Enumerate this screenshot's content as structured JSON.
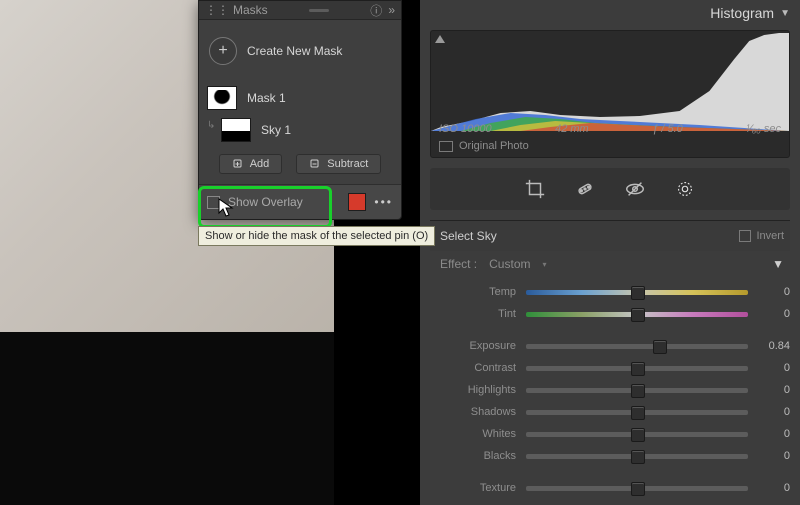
{
  "masks_panel": {
    "title": "Masks",
    "create_label": "Create New Mask",
    "items": [
      {
        "label": "Mask 1"
      },
      {
        "label": "Sky 1"
      }
    ],
    "add_label": "Add",
    "subtract_label": "Subtract",
    "show_overlay_label": "Show Overlay",
    "overlay_color": "#d63a2b",
    "tooltip": "Show or hide the mask of the selected pin (O)"
  },
  "right": {
    "histogram_title": "Histogram",
    "meta": {
      "iso": "ISO 10000",
      "focal": "42 mm",
      "aperture": "ƒ / 5.0",
      "shutter": "¹⁄₆₀ sec"
    },
    "original_photo": "Original Photo",
    "section": "Select Sky",
    "invert_label": "Invert",
    "effect_label": "Effect :",
    "effect_value": "Custom",
    "sliders": [
      {
        "name": "Temp",
        "value": "0",
        "pos": 50,
        "track": "temp"
      },
      {
        "name": "Tint",
        "value": "0",
        "pos": 50,
        "track": "tint"
      },
      {
        "name": "Exposure",
        "value": "0.84",
        "pos": 60,
        "track": ""
      },
      {
        "name": "Contrast",
        "value": "0",
        "pos": 50,
        "track": ""
      },
      {
        "name": "Highlights",
        "value": "0",
        "pos": 50,
        "track": ""
      },
      {
        "name": "Shadows",
        "value": "0",
        "pos": 50,
        "track": ""
      },
      {
        "name": "Whites",
        "value": "0",
        "pos": 50,
        "track": ""
      },
      {
        "name": "Blacks",
        "value": "0",
        "pos": 50,
        "track": ""
      },
      {
        "name": "Texture",
        "value": "0",
        "pos": 50,
        "track": ""
      }
    ]
  }
}
